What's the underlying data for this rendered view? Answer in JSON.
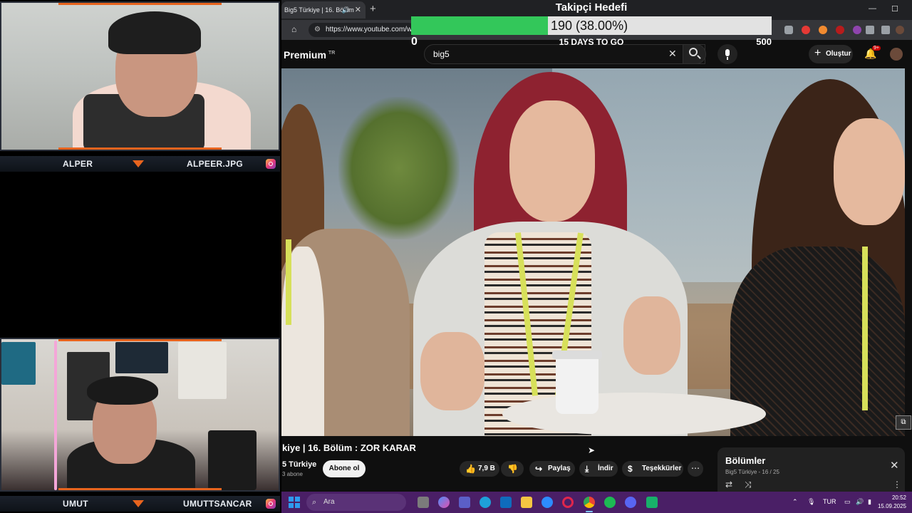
{
  "overlay": {
    "cam1_left_name": "ALPER",
    "cam1_right_name": "ALPEER.JPG",
    "cam2_left_name": "UMUT",
    "cam2_right_name": "UMUTTSANCAR",
    "accent_color": "#e8641e"
  },
  "goal": {
    "title": "Takipçi Hedefi",
    "progress_text": "190 (38.00%)",
    "progress_fraction": 0.38,
    "min": "0",
    "max": "500",
    "subtitle": "15 DAYS TO GO",
    "fill_color": "#33c75a"
  },
  "browser": {
    "tab_title": "Big5 Türkiye | 16. Bölüm",
    "url": "https://www.youtube.com/wa",
    "new_tab": "+",
    "tab_close": "✕"
  },
  "youtube": {
    "logo_text": "Premium",
    "logo_region": "TR",
    "search_value": "big5",
    "create_label": "Oluştur",
    "notif_badge": "9+"
  },
  "video": {
    "title": "kiye | 16. Bölüm : ZOR KARAR",
    "channel": "5 Türkiye",
    "subscribers": "3 abone",
    "subscribe_label": "Abone ol",
    "likes": "7,9 B",
    "share_label": "Paylaş",
    "download_label": "İndir",
    "thanks_label": "Teşekkürler"
  },
  "episodes": {
    "title": "Bölümler",
    "subtitle": "Big5 Türkiye - 16 / 25"
  },
  "taskbar": {
    "search_placeholder": "Ara",
    "lang": "TUR",
    "time": "20:52",
    "date": "15.09.2025"
  }
}
